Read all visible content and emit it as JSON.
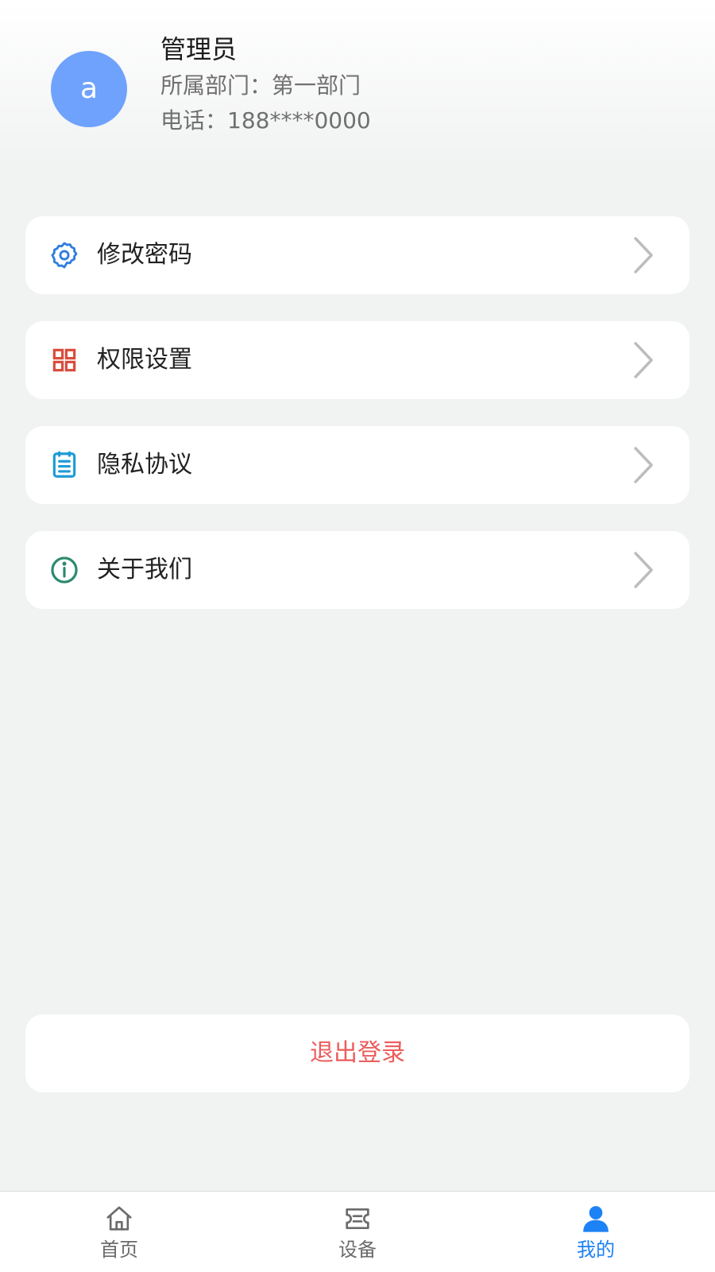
{
  "profile": {
    "avatar_letter": "a",
    "avatar_color": "#6fa2fd",
    "name": "管理员",
    "department": "所属部门：第一部门",
    "phone": "电话：188****0000"
  },
  "menu": {
    "items": [
      {
        "label": "修改密码",
        "icon": "gear-icon",
        "icon_color": "#2f7de0"
      },
      {
        "label": "权限设置",
        "icon": "grid-icon",
        "icon_color": "#d84b3c"
      },
      {
        "label": "隐私协议",
        "icon": "document-icon",
        "icon_color": "#1e9bd8"
      },
      {
        "label": "关于我们",
        "icon": "info-icon",
        "icon_color": "#2a8a6e"
      }
    ]
  },
  "logout": {
    "label": "退出登录",
    "color": "#ec5c5c"
  },
  "tabbar": {
    "tabs": [
      {
        "label": "首页",
        "icon": "home-icon",
        "active": false
      },
      {
        "label": "设备",
        "icon": "device-icon",
        "active": false
      },
      {
        "label": "我的",
        "icon": "user-icon",
        "active": true
      }
    ],
    "active_color": "#1d82f5",
    "inactive_color": "#6b6b6b"
  }
}
